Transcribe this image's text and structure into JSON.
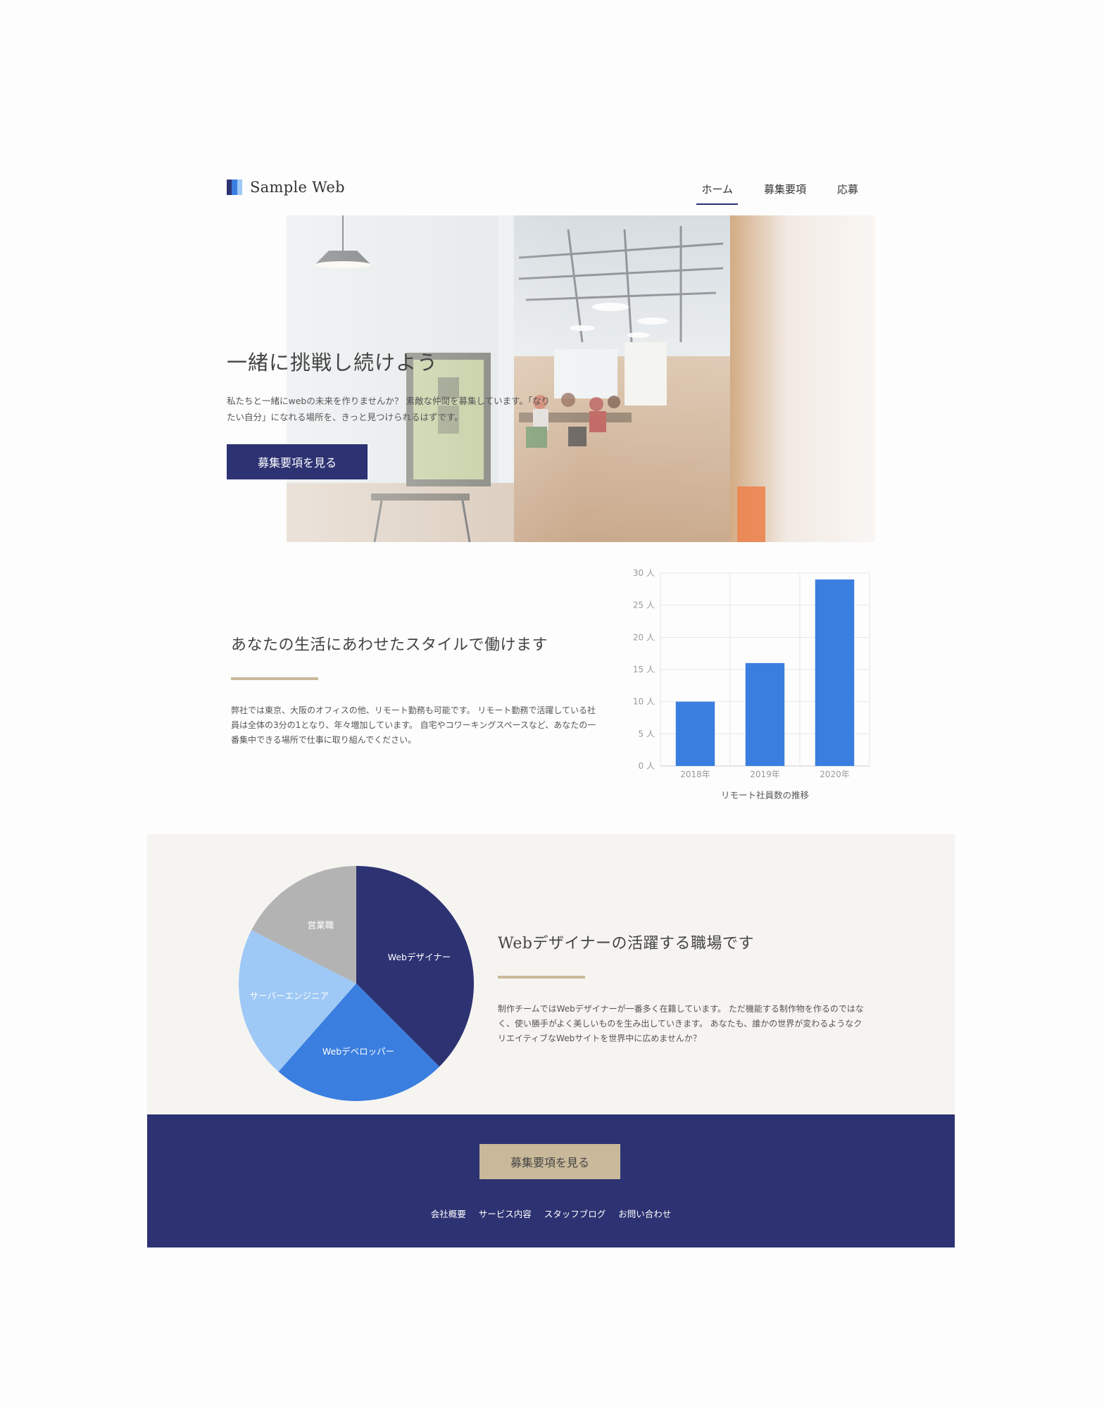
{
  "header": {
    "logo_text": "Sample Web",
    "logo_colors": [
      "#2d3272",
      "#3a7ee0",
      "#9ec8f5"
    ],
    "nav": [
      {
        "label": "ホーム",
        "active": true
      },
      {
        "label": "募集要項",
        "active": false
      },
      {
        "label": "応募",
        "active": false
      }
    ]
  },
  "hero": {
    "title": "一緒に挑戦し続けよう",
    "description": "私たちと一緒にwebの未来を作りませんか？ 素敵な仲間を募集しています。「なりたい自分」になれる場所を、きっと見つけられるはずです。",
    "button_label": "募集要項を見る"
  },
  "style_section": {
    "title": "あなたの生活にあわせたスタイルで働けます",
    "description": "弊社では東京、大阪のオフィスの他、リモート勤務も可能です。 リモート勤務で活躍している社員は全体の3分の1となり、年々増加しています。 自宅やコワーキングスペースなど、あなたの一番集中できる場所で仕事に取り組んでください。"
  },
  "designer_section": {
    "title": "Webデザイナーの活躍する職場です",
    "description": "制作チームではWebデザイナーが一番多く在籍しています。 ただ機能する制作物を作るのではなく、使い勝手がよく美しいものを生み出していきます。 あなたも、誰かの世界が変わるようなクリエイティブなWebサイトを世界中に広めませんか？"
  },
  "footer": {
    "button_label": "募集要項を見る",
    "links": [
      "会社概要",
      "サービス内容",
      "スタッフブログ",
      "お問い合わせ"
    ]
  },
  "colors": {
    "navy": "#2d3272",
    "accent_gold": "#c9b99a",
    "bar_blue": "#3a7ee0",
    "section_gray": "#f6f4f1"
  },
  "chart_data": [
    {
      "type": "bar",
      "categories": [
        "2018年",
        "2019年",
        "2020年"
      ],
      "values": [
        10,
        16,
        29
      ],
      "ylim": [
        0,
        30
      ],
      "y_ticks": [
        "0 人",
        "5 人",
        "10 人",
        "15 人",
        "20 人",
        "25 人",
        "30 人"
      ],
      "xlabel": "リモート社員数の推移",
      "ylabel": "",
      "grid": true,
      "color": "#3a7ee0"
    },
    {
      "type": "pie",
      "slices": [
        {
          "label": "Webデザイナー",
          "value": 37.5,
          "color": "#2d3272"
        },
        {
          "label": "Webデベロッパー",
          "value": 24,
          "color": "#3a7ee0"
        },
        {
          "label": "サーバーエンジニア",
          "value": 21,
          "color": "#9ec8f5"
        },
        {
          "label": "営業職",
          "value": 17.5,
          "color": "#b3b3b3"
        }
      ]
    }
  ]
}
